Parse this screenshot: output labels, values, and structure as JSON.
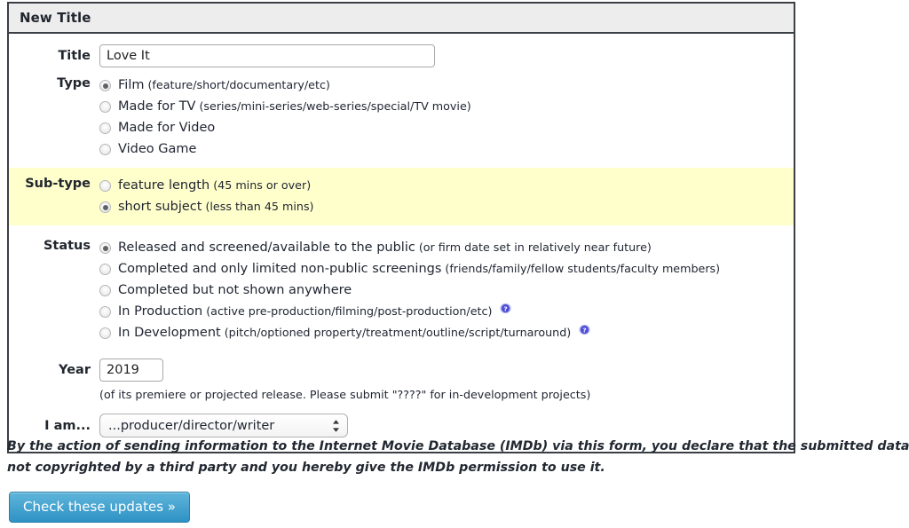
{
  "panel": {
    "header_title": "New Title"
  },
  "fields": {
    "title": {
      "label": "Title",
      "value": "Love It",
      "placeholder": ""
    },
    "type": {
      "label": "Type",
      "options": [
        {
          "main": "Film",
          "sub": "(feature/short/documentary/etc)",
          "checked": true
        },
        {
          "main": "Made for TV",
          "sub": "(series/mini-series/web-series/special/TV movie)",
          "checked": false
        },
        {
          "main": "Made for Video",
          "sub": "",
          "checked": false
        },
        {
          "main": "Video Game",
          "sub": "",
          "checked": false
        }
      ]
    },
    "subtype": {
      "label": "Sub-type",
      "options": [
        {
          "main": "feature length",
          "sub": "(45 mins or over)",
          "checked": false
        },
        {
          "main": "short subject",
          "sub": "(less than 45 mins)",
          "checked": true
        }
      ]
    },
    "status": {
      "label": "Status",
      "options": [
        {
          "main": "Released and screened/available to the public",
          "sub": "(or firm date set in relatively near future)",
          "checked": true,
          "help": false
        },
        {
          "main": "Completed and only limited non-public screenings",
          "sub": "(friends/family/fellow students/faculty members)",
          "checked": false,
          "help": false
        },
        {
          "main": "Completed but not shown anywhere",
          "sub": "",
          "checked": false,
          "help": false
        },
        {
          "main": "In Production",
          "sub": "(active pre-production/filming/post-production/etc)",
          "checked": false,
          "help": true
        },
        {
          "main": "In Development",
          "sub": "(pitch/optioned property/treatment/outline/script/turnaround)",
          "checked": false,
          "help": true
        }
      ]
    },
    "year": {
      "label": "Year",
      "value": "2019",
      "hint": "(of its premiere or projected release. Please submit \"????\" for in-development projects)"
    },
    "iam": {
      "label": "I am...",
      "selected": "...producer/director/writer"
    }
  },
  "disclaimer": {
    "line1": "By the action of sending information to the Internet Movie Database (IMDb) via this form, you declare that the submitted data is correct and",
    "line2": "not copyrighted by a third party and you hereby give the IMDb permission to use it."
  },
  "submit": {
    "label": "Check these updates »"
  },
  "colors": {
    "highlight": "#ffffcc",
    "panel_border": "#3a3f45",
    "header_bg": "#ededed",
    "button_top": "#5fb5db",
    "button_bottom": "#2e92c4",
    "help_icon": "#5a5ad2"
  }
}
